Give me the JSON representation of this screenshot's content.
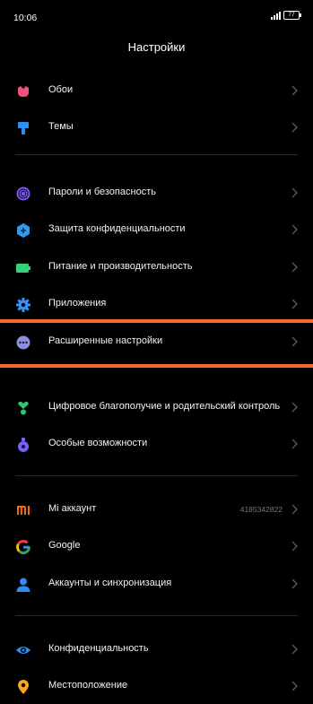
{
  "status": {
    "time": "10:06",
    "battery": "77"
  },
  "header": {
    "title": "Настройки"
  },
  "settings": [
    {
      "label": "Обои"
    },
    {
      "label": "Темы"
    },
    {
      "label": "Пароли и безопасность"
    },
    {
      "label": "Защита конфиденциальности"
    },
    {
      "label": "Питание и производительность"
    },
    {
      "label": "Приложения"
    },
    {
      "label": "Расширенные настройки"
    },
    {
      "label": "Цифровое благополучие и родительский контроль"
    },
    {
      "label": "Особые возможности"
    },
    {
      "label": "Mi аккаунт",
      "value": "4185342822"
    },
    {
      "label": "Google"
    },
    {
      "label": "Аккаунты и синхронизация"
    },
    {
      "label": "Конфиденциальность"
    },
    {
      "label": "Местоположение"
    }
  ],
  "icons": [
    "wallpaper-icon",
    "themes-icon",
    "fingerprint-icon",
    "privacy-shield-icon",
    "battery-icon",
    "apps-gear-icon",
    "more-dots-icon",
    "wellbeing-icon",
    "accessibility-icon",
    "mi-logo-icon",
    "google-icon",
    "account-icon",
    "eye-icon",
    "location-pin-icon"
  ],
  "colors": {
    "highlight": "#f26a2c",
    "divider": "#2a2a2a",
    "chevron": "#5a5a5a"
  }
}
